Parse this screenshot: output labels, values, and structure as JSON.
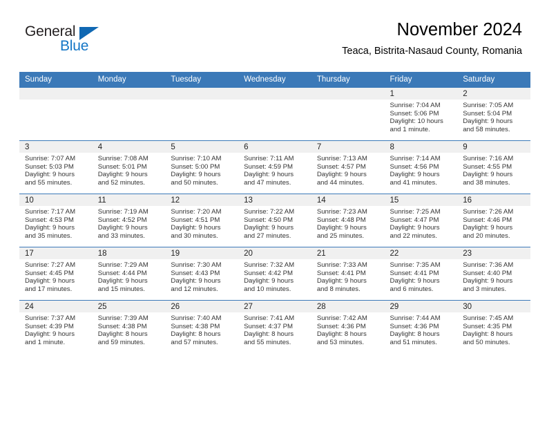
{
  "brand": {
    "name_dark": "General",
    "name_blue": "Blue",
    "accent_color": "#1068b3"
  },
  "header": {
    "title": "November 2024",
    "subtitle": "Teaca, Bistrita-Nasaud County, Romania"
  },
  "theme": {
    "header_bg": "#3b79b8",
    "daynum_bg": "#f0f0f0",
    "text": "#333333"
  },
  "weekday_headers": [
    "Sunday",
    "Monday",
    "Tuesday",
    "Wednesday",
    "Thursday",
    "Friday",
    "Saturday"
  ],
  "weeks": [
    [
      {
        "day": "",
        "empty": true,
        "sunrise": "",
        "sunset": "",
        "daylight_1": "",
        "daylight_2": ""
      },
      {
        "day": "",
        "empty": true,
        "sunrise": "",
        "sunset": "",
        "daylight_1": "",
        "daylight_2": ""
      },
      {
        "day": "",
        "empty": true,
        "sunrise": "",
        "sunset": "",
        "daylight_1": "",
        "daylight_2": ""
      },
      {
        "day": "",
        "empty": true,
        "sunrise": "",
        "sunset": "",
        "daylight_1": "",
        "daylight_2": ""
      },
      {
        "day": "",
        "empty": true,
        "sunrise": "",
        "sunset": "",
        "daylight_1": "",
        "daylight_2": ""
      },
      {
        "day": "1",
        "empty": false,
        "sunrise": "Sunrise: 7:04 AM",
        "sunset": "Sunset: 5:06 PM",
        "daylight_1": "Daylight: 10 hours",
        "daylight_2": "and 1 minute."
      },
      {
        "day": "2",
        "empty": false,
        "sunrise": "Sunrise: 7:05 AM",
        "sunset": "Sunset: 5:04 PM",
        "daylight_1": "Daylight: 9 hours",
        "daylight_2": "and 58 minutes."
      }
    ],
    [
      {
        "day": "3",
        "empty": false,
        "sunrise": "Sunrise: 7:07 AM",
        "sunset": "Sunset: 5:03 PM",
        "daylight_1": "Daylight: 9 hours",
        "daylight_2": "and 55 minutes."
      },
      {
        "day": "4",
        "empty": false,
        "sunrise": "Sunrise: 7:08 AM",
        "sunset": "Sunset: 5:01 PM",
        "daylight_1": "Daylight: 9 hours",
        "daylight_2": "and 52 minutes."
      },
      {
        "day": "5",
        "empty": false,
        "sunrise": "Sunrise: 7:10 AM",
        "sunset": "Sunset: 5:00 PM",
        "daylight_1": "Daylight: 9 hours",
        "daylight_2": "and 50 minutes."
      },
      {
        "day": "6",
        "empty": false,
        "sunrise": "Sunrise: 7:11 AM",
        "sunset": "Sunset: 4:59 PM",
        "daylight_1": "Daylight: 9 hours",
        "daylight_2": "and 47 minutes."
      },
      {
        "day": "7",
        "empty": false,
        "sunrise": "Sunrise: 7:13 AM",
        "sunset": "Sunset: 4:57 PM",
        "daylight_1": "Daylight: 9 hours",
        "daylight_2": "and 44 minutes."
      },
      {
        "day": "8",
        "empty": false,
        "sunrise": "Sunrise: 7:14 AM",
        "sunset": "Sunset: 4:56 PM",
        "daylight_1": "Daylight: 9 hours",
        "daylight_2": "and 41 minutes."
      },
      {
        "day": "9",
        "empty": false,
        "sunrise": "Sunrise: 7:16 AM",
        "sunset": "Sunset: 4:55 PM",
        "daylight_1": "Daylight: 9 hours",
        "daylight_2": "and 38 minutes."
      }
    ],
    [
      {
        "day": "10",
        "empty": false,
        "sunrise": "Sunrise: 7:17 AM",
        "sunset": "Sunset: 4:53 PM",
        "daylight_1": "Daylight: 9 hours",
        "daylight_2": "and 35 minutes."
      },
      {
        "day": "11",
        "empty": false,
        "sunrise": "Sunrise: 7:19 AM",
        "sunset": "Sunset: 4:52 PM",
        "daylight_1": "Daylight: 9 hours",
        "daylight_2": "and 33 minutes."
      },
      {
        "day": "12",
        "empty": false,
        "sunrise": "Sunrise: 7:20 AM",
        "sunset": "Sunset: 4:51 PM",
        "daylight_1": "Daylight: 9 hours",
        "daylight_2": "and 30 minutes."
      },
      {
        "day": "13",
        "empty": false,
        "sunrise": "Sunrise: 7:22 AM",
        "sunset": "Sunset: 4:50 PM",
        "daylight_1": "Daylight: 9 hours",
        "daylight_2": "and 27 minutes."
      },
      {
        "day": "14",
        "empty": false,
        "sunrise": "Sunrise: 7:23 AM",
        "sunset": "Sunset: 4:48 PM",
        "daylight_1": "Daylight: 9 hours",
        "daylight_2": "and 25 minutes."
      },
      {
        "day": "15",
        "empty": false,
        "sunrise": "Sunrise: 7:25 AM",
        "sunset": "Sunset: 4:47 PM",
        "daylight_1": "Daylight: 9 hours",
        "daylight_2": "and 22 minutes."
      },
      {
        "day": "16",
        "empty": false,
        "sunrise": "Sunrise: 7:26 AM",
        "sunset": "Sunset: 4:46 PM",
        "daylight_1": "Daylight: 9 hours",
        "daylight_2": "and 20 minutes."
      }
    ],
    [
      {
        "day": "17",
        "empty": false,
        "sunrise": "Sunrise: 7:27 AM",
        "sunset": "Sunset: 4:45 PM",
        "daylight_1": "Daylight: 9 hours",
        "daylight_2": "and 17 minutes."
      },
      {
        "day": "18",
        "empty": false,
        "sunrise": "Sunrise: 7:29 AM",
        "sunset": "Sunset: 4:44 PM",
        "daylight_1": "Daylight: 9 hours",
        "daylight_2": "and 15 minutes."
      },
      {
        "day": "19",
        "empty": false,
        "sunrise": "Sunrise: 7:30 AM",
        "sunset": "Sunset: 4:43 PM",
        "daylight_1": "Daylight: 9 hours",
        "daylight_2": "and 12 minutes."
      },
      {
        "day": "20",
        "empty": false,
        "sunrise": "Sunrise: 7:32 AM",
        "sunset": "Sunset: 4:42 PM",
        "daylight_1": "Daylight: 9 hours",
        "daylight_2": "and 10 minutes."
      },
      {
        "day": "21",
        "empty": false,
        "sunrise": "Sunrise: 7:33 AM",
        "sunset": "Sunset: 4:41 PM",
        "daylight_1": "Daylight: 9 hours",
        "daylight_2": "and 8 minutes."
      },
      {
        "day": "22",
        "empty": false,
        "sunrise": "Sunrise: 7:35 AM",
        "sunset": "Sunset: 4:41 PM",
        "daylight_1": "Daylight: 9 hours",
        "daylight_2": "and 6 minutes."
      },
      {
        "day": "23",
        "empty": false,
        "sunrise": "Sunrise: 7:36 AM",
        "sunset": "Sunset: 4:40 PM",
        "daylight_1": "Daylight: 9 hours",
        "daylight_2": "and 3 minutes."
      }
    ],
    [
      {
        "day": "24",
        "empty": false,
        "sunrise": "Sunrise: 7:37 AM",
        "sunset": "Sunset: 4:39 PM",
        "daylight_1": "Daylight: 9 hours",
        "daylight_2": "and 1 minute."
      },
      {
        "day": "25",
        "empty": false,
        "sunrise": "Sunrise: 7:39 AM",
        "sunset": "Sunset: 4:38 PM",
        "daylight_1": "Daylight: 8 hours",
        "daylight_2": "and 59 minutes."
      },
      {
        "day": "26",
        "empty": false,
        "sunrise": "Sunrise: 7:40 AM",
        "sunset": "Sunset: 4:38 PM",
        "daylight_1": "Daylight: 8 hours",
        "daylight_2": "and 57 minutes."
      },
      {
        "day": "27",
        "empty": false,
        "sunrise": "Sunrise: 7:41 AM",
        "sunset": "Sunset: 4:37 PM",
        "daylight_1": "Daylight: 8 hours",
        "daylight_2": "and 55 minutes."
      },
      {
        "day": "28",
        "empty": false,
        "sunrise": "Sunrise: 7:42 AM",
        "sunset": "Sunset: 4:36 PM",
        "daylight_1": "Daylight: 8 hours",
        "daylight_2": "and 53 minutes."
      },
      {
        "day": "29",
        "empty": false,
        "sunrise": "Sunrise: 7:44 AM",
        "sunset": "Sunset: 4:36 PM",
        "daylight_1": "Daylight: 8 hours",
        "daylight_2": "and 51 minutes."
      },
      {
        "day": "30",
        "empty": false,
        "sunrise": "Sunrise: 7:45 AM",
        "sunset": "Sunset: 4:35 PM",
        "daylight_1": "Daylight: 8 hours",
        "daylight_2": "and 50 minutes."
      }
    ]
  ]
}
